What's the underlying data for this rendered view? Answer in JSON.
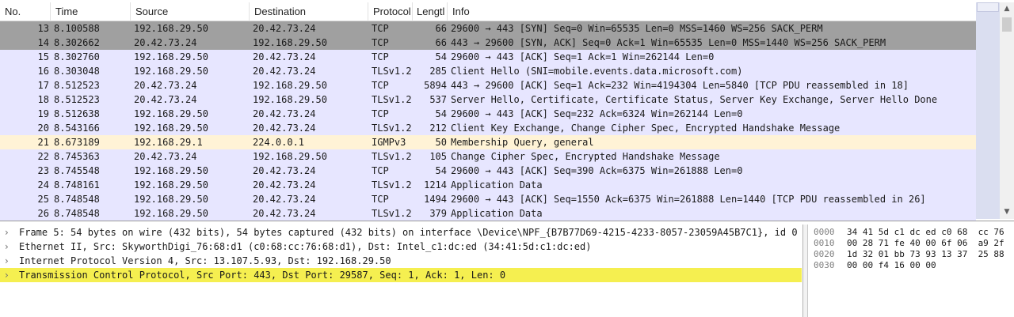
{
  "packet_list": {
    "columns": [
      "No.",
      "Time",
      "Source",
      "Destination",
      "Protocol",
      "Lengtl",
      "Info"
    ],
    "rows": [
      {
        "no": "13",
        "time": "8.100588",
        "src": "192.168.29.50",
        "dst": "20.42.73.24",
        "proto": "TCP",
        "len": "66",
        "info": "29600 → 443 [SYN] Seq=0 Win=65535 Len=0 MSS=1460 WS=256 SACK_PERM",
        "bg": "#a0a0a0"
      },
      {
        "no": "14",
        "time": "8.302662",
        "src": "20.42.73.24",
        "dst": "192.168.29.50",
        "proto": "TCP",
        "len": "66",
        "info": "443 → 29600 [SYN, ACK] Seq=0 Ack=1 Win=65535 Len=0 MSS=1440 WS=256 SACK_PERM",
        "bg": "#a0a0a0"
      },
      {
        "no": "15",
        "time": "8.302760",
        "src": "192.168.29.50",
        "dst": "20.42.73.24",
        "proto": "TCP",
        "len": "54",
        "info": "29600 → 443 [ACK] Seq=1 Ack=1 Win=262144 Len=0",
        "bg": "#e7e6ff"
      },
      {
        "no": "16",
        "time": "8.303048",
        "src": "192.168.29.50",
        "dst": "20.42.73.24",
        "proto": "TLSv1.2",
        "len": "285",
        "info": "Client Hello (SNI=mobile.events.data.microsoft.com)",
        "bg": "#e7e6ff"
      },
      {
        "no": "17",
        "time": "8.512523",
        "src": "20.42.73.24",
        "dst": "192.168.29.50",
        "proto": "TCP",
        "len": "5894",
        "info": "443 → 29600 [ACK] Seq=1 Ack=232 Win=4194304 Len=5840 [TCP PDU reassembled in 18]",
        "bg": "#e7e6ff"
      },
      {
        "no": "18",
        "time": "8.512523",
        "src": "20.42.73.24",
        "dst": "192.168.29.50",
        "proto": "TLSv1.2",
        "len": "537",
        "info": "Server Hello, Certificate, Certificate Status, Server Key Exchange, Server Hello Done",
        "bg": "#e7e6ff"
      },
      {
        "no": "19",
        "time": "8.512638",
        "src": "192.168.29.50",
        "dst": "20.42.73.24",
        "proto": "TCP",
        "len": "54",
        "info": "29600 → 443 [ACK] Seq=232 Ack=6324 Win=262144 Len=0",
        "bg": "#e7e6ff"
      },
      {
        "no": "20",
        "time": "8.543166",
        "src": "192.168.29.50",
        "dst": "20.42.73.24",
        "proto": "TLSv1.2",
        "len": "212",
        "info": "Client Key Exchange, Change Cipher Spec, Encrypted Handshake Message",
        "bg": "#e7e6ff"
      },
      {
        "no": "21",
        "time": "8.673189",
        "src": "192.168.29.1",
        "dst": "224.0.0.1",
        "proto": "IGMPv3",
        "len": "50",
        "info": "Membership Query, general",
        "bg": "#fff3d6"
      },
      {
        "no": "22",
        "time": "8.745363",
        "src": "20.42.73.24",
        "dst": "192.168.29.50",
        "proto": "TLSv1.2",
        "len": "105",
        "info": "Change Cipher Spec, Encrypted Handshake Message",
        "bg": "#e7e6ff"
      },
      {
        "no": "23",
        "time": "8.745548",
        "src": "192.168.29.50",
        "dst": "20.42.73.24",
        "proto": "TCP",
        "len": "54",
        "info": "29600 → 443 [ACK] Seq=390 Ack=6375 Win=261888 Len=0",
        "bg": "#e7e6ff"
      },
      {
        "no": "24",
        "time": "8.748161",
        "src": "192.168.29.50",
        "dst": "20.42.73.24",
        "proto": "TLSv1.2",
        "len": "1214",
        "info": "Application Data",
        "bg": "#e7e6ff"
      },
      {
        "no": "25",
        "time": "8.748548",
        "src": "192.168.29.50",
        "dst": "20.42.73.24",
        "proto": "TCP",
        "len": "1494",
        "info": "29600 → 443 [ACK] Seq=1550 Ack=6375 Win=261888 Len=1440 [TCP PDU reassembled in 26]",
        "bg": "#e7e6ff"
      },
      {
        "no": "26",
        "time": "8.748548",
        "src": "192.168.29.50",
        "dst": "20.42.73.24",
        "proto": "TLSv1.2",
        "len": "379",
        "info": "Application Data",
        "bg": "#e7e6ff"
      }
    ]
  },
  "details": {
    "items": [
      {
        "text": "Frame 5: 54 bytes on wire (432 bits), 54 bytes captured (432 bits) on interface \\Device\\NPF_{B7B77D69-4215-4233-8057-23059A45B7C1}, id 0",
        "bg": "#ffffff"
      },
      {
        "text": "Ethernet II, Src: SkyworthDigi_76:68:d1 (c0:68:cc:76:68:d1), Dst: Intel_c1:dc:ed (34:41:5d:c1:dc:ed)",
        "bg": "#ffffff"
      },
      {
        "text": "Internet Protocol Version 4, Src: 13.107.5.93, Dst: 192.168.29.50",
        "bg": "#ffffff"
      },
      {
        "text": "Transmission Control Protocol, Src Port: 443, Dst Port: 29587, Seq: 1, Ack: 1, Len: 0",
        "bg": "#f5ef50"
      }
    ],
    "arrow_icon": "chevron-right-icon"
  },
  "bytes": {
    "rows": [
      {
        "offset": "0000",
        "hex": "34 41 5d c1 dc ed c0 68  cc 76"
      },
      {
        "offset": "0010",
        "hex": "00 28 71 fe 40 00 6f 06  a9 2f"
      },
      {
        "offset": "0020",
        "hex": "1d 32 01 bb 73 93 13 37  25 88"
      },
      {
        "offset": "0030",
        "hex": "00 00 f4 16 00 00"
      }
    ]
  }
}
